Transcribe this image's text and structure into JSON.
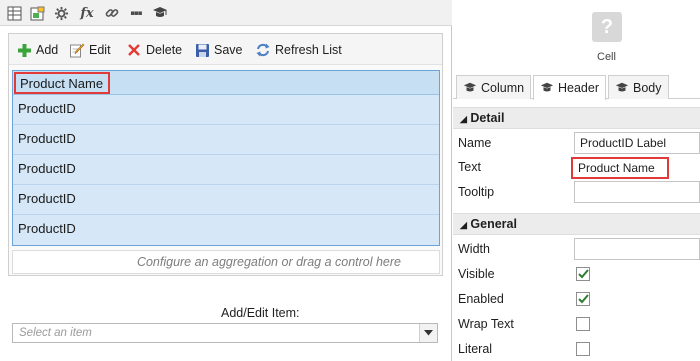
{
  "toolbar": {
    "icons": [
      "grid-icon",
      "form-image-icon",
      "gear-icon",
      "fx-icon",
      "link-icon",
      "more-icon",
      "mortarboard-icon"
    ],
    "fx_glyph": "fx",
    "more_glyph": "▪▪▪"
  },
  "list": {
    "buttons": [
      {
        "label": "Add",
        "icon": "plus-icon"
      },
      {
        "label": "Edit",
        "icon": "edit-icon"
      },
      {
        "label": "Delete",
        "icon": "x-icon"
      },
      {
        "label": "Save",
        "icon": "floppy-icon"
      },
      {
        "label": "Refresh List",
        "icon": "refresh-icon"
      }
    ],
    "header": "Product Name",
    "rows": [
      "ProductID",
      "ProductID",
      "ProductID",
      "ProductID",
      "ProductID"
    ],
    "aggregation_hint": "Configure an aggregation or drag a control here"
  },
  "add_edit": {
    "label": "Add/Edit Item:",
    "placeholder": "Select an item"
  },
  "properties": {
    "cell_icon_glyph": "?",
    "cell_label": "Cell",
    "tabs": [
      {
        "label": "Column",
        "active": false
      },
      {
        "label": "Header",
        "active": true
      },
      {
        "label": "Body",
        "active": false
      }
    ],
    "detail": {
      "heading": "Detail",
      "name_label": "Name",
      "name_value": "ProductID Label",
      "text_label": "Text",
      "text_value": "Product Name",
      "tooltip_label": "Tooltip",
      "tooltip_value": ""
    },
    "general": {
      "heading": "General",
      "width_label": "Width",
      "width_value": "",
      "visible_label": "Visible",
      "visible_checked": true,
      "enabled_label": "Enabled",
      "enabled_checked": true,
      "wrap_label": "Wrap Text",
      "wrap_checked": false,
      "literal_label": "Literal",
      "literal_checked": false
    }
  },
  "colors": {
    "highlight": "#e23a3a",
    "selection": "#d6e8f7",
    "accent": "#2e7d32"
  }
}
